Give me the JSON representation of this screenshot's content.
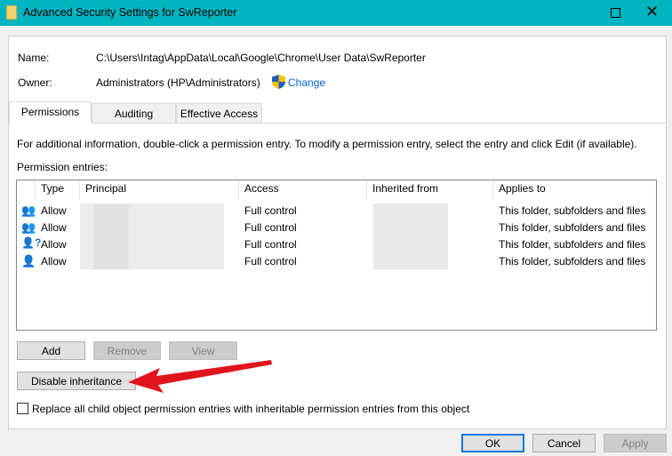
{
  "window": {
    "title": "Advanced Security Settings for SwReporter",
    "icon": "folder-icon"
  },
  "info": {
    "name_label": "Name:",
    "name_value": "C:\\Users\\Intag\\AppData\\Local\\Google\\Chrome\\User Data\\SwReporter",
    "owner_label": "Owner:",
    "owner_value": "Administrators (HP\\Administrators)",
    "change_link": "Change"
  },
  "tabs": [
    {
      "label": "Permissions",
      "active": true
    },
    {
      "label": "Auditing"
    },
    {
      "label": "Effective Access"
    }
  ],
  "instructions": "For additional information, double-click a permission entry. To modify a permission entry, select the entry and click Edit (if available).",
  "entries_label": "Permission entries:",
  "columns": [
    "Type",
    "Principal",
    "Access",
    "Inherited from",
    "Applies to"
  ],
  "rows": [
    {
      "icon": "user-group-icon",
      "type": "Allow",
      "access": "Full control",
      "applies": "This folder, subfolders and files"
    },
    {
      "icon": "user-group-icon",
      "type": "Allow",
      "access": "Full control",
      "applies": "This folder, subfolders and files"
    },
    {
      "icon": "unknown-user-icon",
      "type": "Allow",
      "access": "Full control",
      "applies": "This folder, subfolders and files"
    },
    {
      "icon": "user-icon",
      "type": "Allow",
      "access": "Full control",
      "applies": "This folder, subfolders and files"
    }
  ],
  "buttons": {
    "add": "Add",
    "remove": "Remove",
    "view": "View",
    "disable_inheritance": "Disable inheritance",
    "ok": "OK",
    "cancel": "Cancel",
    "apply": "Apply"
  },
  "replace_checkbox": {
    "label": "Replace all child object permission entries with inheritable permission entries from this object",
    "checked": false
  },
  "colors": {
    "titlebar": "#00b4c0",
    "link": "#0066cc",
    "annotation_arrow": "#e0141c"
  }
}
